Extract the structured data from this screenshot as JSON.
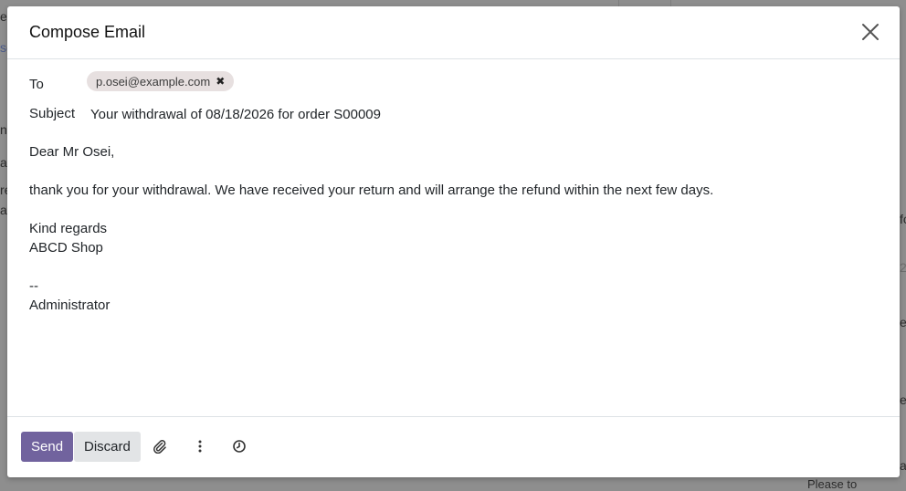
{
  "background": {
    "fragments": [
      "er",
      "se",
      "n",
      "as",
      "re",
      "at",
      "fo",
      "2",
      "er",
      "e.",
      "a",
      "Please to"
    ]
  },
  "dialog": {
    "title": "Compose Email",
    "close_icon": "close-icon"
  },
  "form": {
    "to_label": "To",
    "recipients": [
      {
        "email": "p.osei@example.com",
        "remove_icon": "remove-tag-icon"
      }
    ],
    "subject_label": "Subject",
    "subject_value": "Your withdrawal of 08/18/2026 for order S00009"
  },
  "body": {
    "lines": [
      "Dear Mr Osei,",
      "",
      "thank you for your withdrawal. We have received your return and will arrange the refund within the next few days.",
      "",
      "Kind regards",
      "ABCD Shop",
      "",
      "--",
      "Administrator"
    ]
  },
  "footer": {
    "send_label": "Send",
    "discard_label": "Discard",
    "icons": [
      "paperclip-icon",
      "more-options-icon",
      "clock-icon"
    ]
  },
  "colors": {
    "primary": "#71639e",
    "secondary": "#e2e4e6",
    "tag_bg": "#e7e0e0",
    "backdrop": "#8e8e8e"
  }
}
